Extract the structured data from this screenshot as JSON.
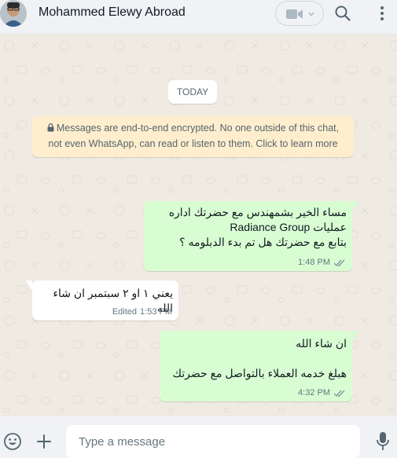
{
  "header": {
    "contact_name": "Mohammed Elewy Abroad",
    "icons": [
      "avatar",
      "video-call-icon",
      "chevron-down-icon",
      "search-icon",
      "menu-icon"
    ]
  },
  "chat": {
    "date_chip": "TODAY",
    "encryption_notice": "Messages are end-to-end encrypted. No one outside of this chat, not even WhatsApp, can read or listen to them. Click to learn more",
    "messages": [
      {
        "direction": "outgoing",
        "text": "مساء الخير بشمهندس  مع حضرتك  اداره\nعمليات Radiance Group\nبتابع مع حضرتك هل تم بدء الدبلومه ؟",
        "time": "1:48 PM",
        "status": "read"
      },
      {
        "direction": "incoming",
        "text": "يعني ١ او ٢ سبتمبر ان شاء الله",
        "edited_label": "Edited",
        "time": "1:53 PM"
      },
      {
        "direction": "outgoing",
        "text": "ان شاء الله\n\nهبلغ خدمه العملاء بالتواصل مع حضرتك",
        "time": "4:32 PM",
        "status": "read"
      }
    ]
  },
  "footer": {
    "input_placeholder": "Type a message",
    "icons": [
      "emoji-icon",
      "attach-plus-icon",
      "microphone-icon"
    ]
  },
  "colors": {
    "outgoing_bubble": "#d9fdd3",
    "incoming_bubble": "#ffffff",
    "chat_background": "#efeae2",
    "read_ticks": "#8696a0",
    "encryption_notice_bg": "#ffeecd"
  }
}
